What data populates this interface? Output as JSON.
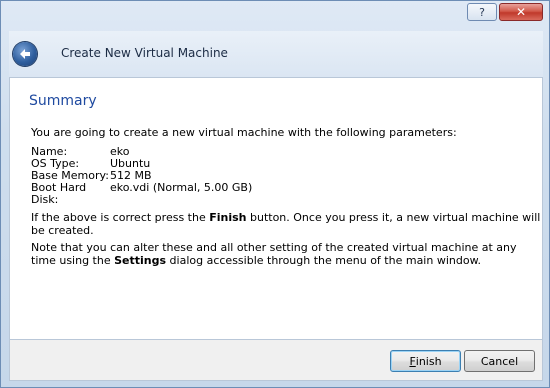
{
  "window": {
    "help_icon": "help-icon",
    "close_icon": "close-icon"
  },
  "header": {
    "title": "Create New Virtual Machine",
    "back_icon": "back-arrow-icon"
  },
  "summary": {
    "heading": "Summary",
    "intro": "You are going to create a new virtual machine with the following parameters:",
    "parameters": [
      {
        "label": "Name:",
        "value": "eko"
      },
      {
        "label": "OS Type:",
        "value": "Ubuntu"
      },
      {
        "label": "Base Memory:",
        "value": "512 MB"
      },
      {
        "label": "Boot Hard Disk:",
        "value": "eko.vdi (Normal, 5.00 GB)"
      }
    ],
    "finish_note_prefix": "If the above is correct press the ",
    "finish_note_bold": "Finish",
    "finish_note_suffix": " button. Once you press it, a new virtual machine will be created.",
    "settings_note_prefix": "Note that you can alter these and all other setting of the created virtual machine at any time using the ",
    "settings_note_bold": "Settings",
    "settings_note_suffix": " dialog accessible through the menu of the main window."
  },
  "buttons": {
    "finish_first": "F",
    "finish_rest": "inish",
    "cancel": "Cancel"
  },
  "colors": {
    "heading": "#1f4aa0",
    "frame": "#cfdeee"
  }
}
